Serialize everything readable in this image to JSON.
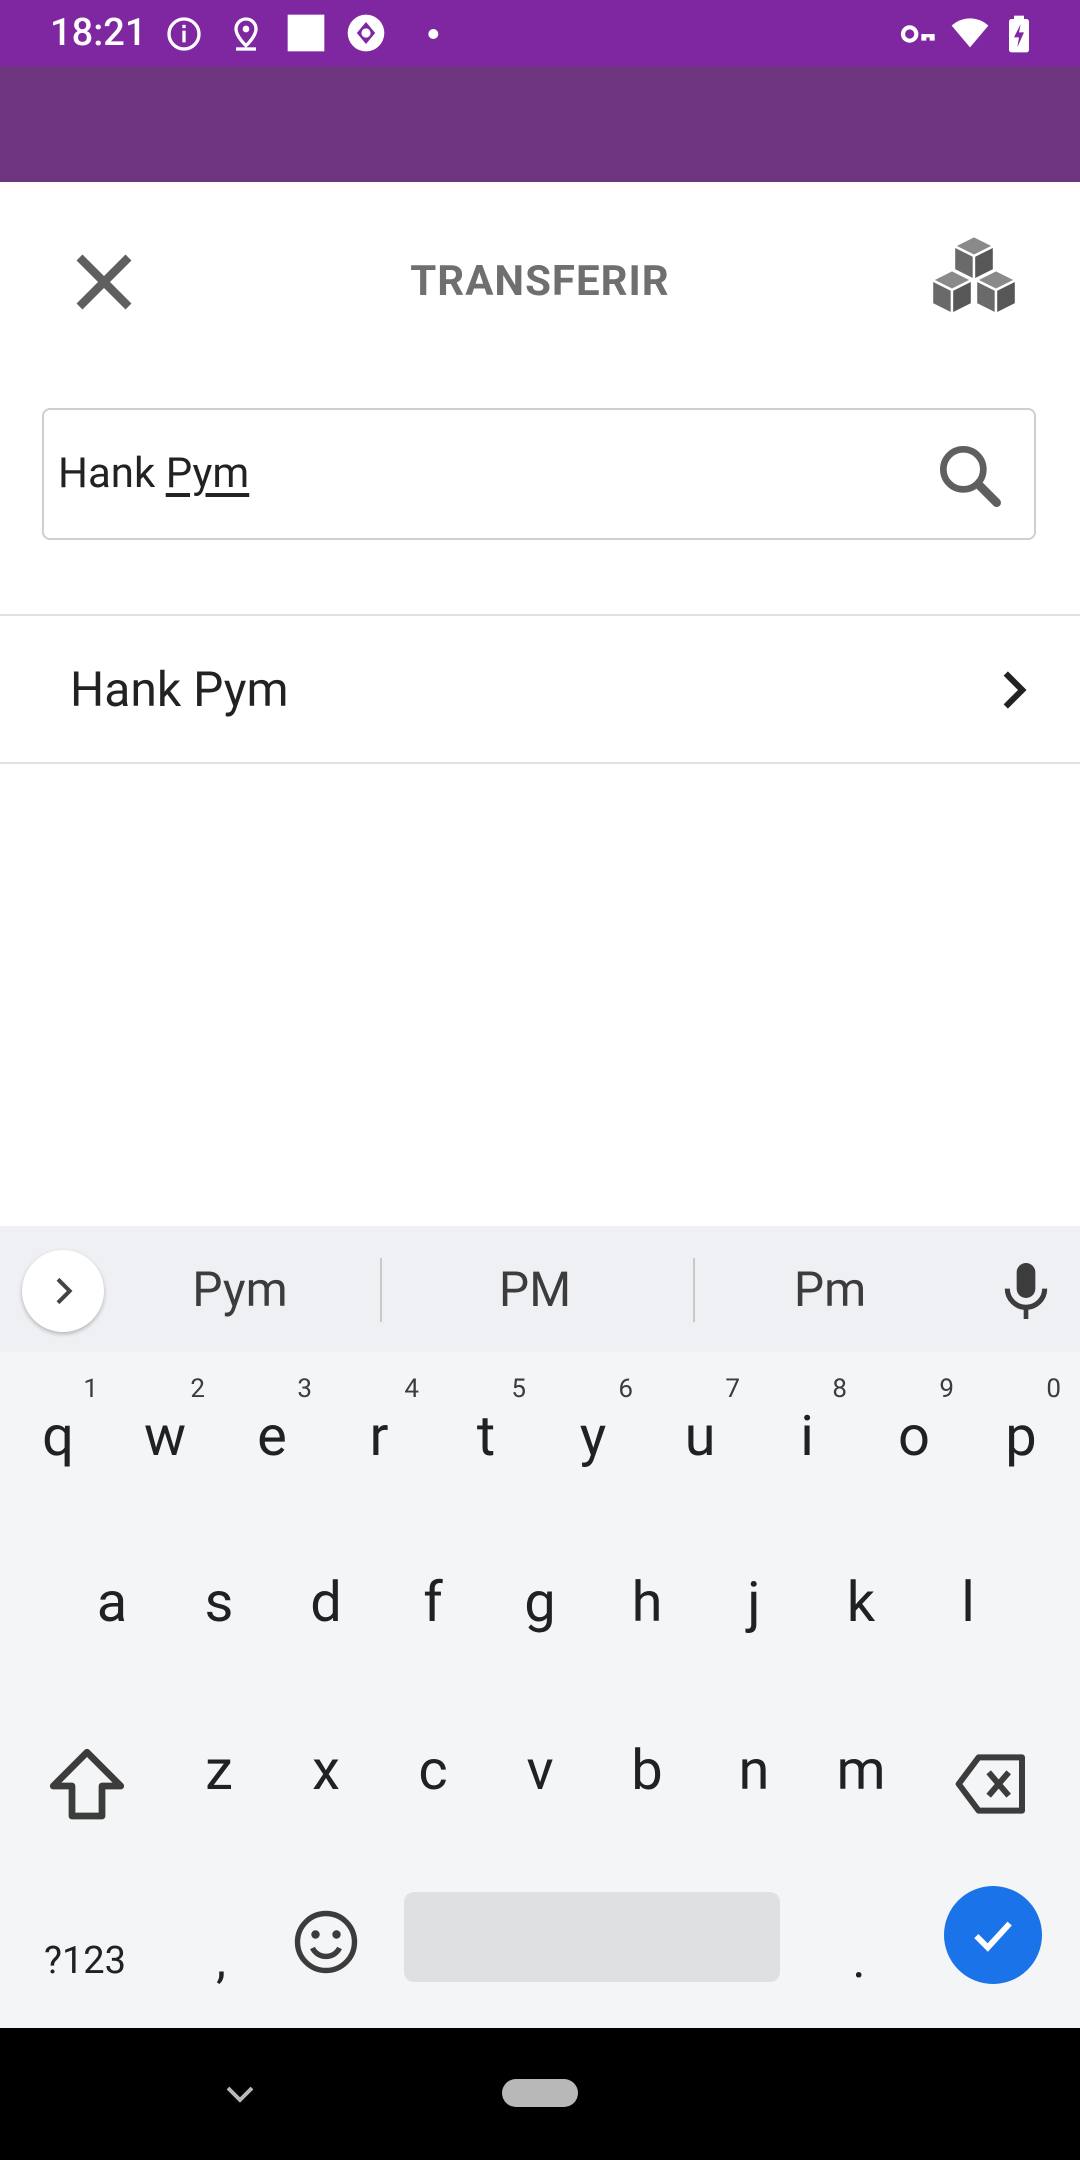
{
  "status_bar": {
    "time": "18:21",
    "bg_color": "#7f27a0",
    "icons": [
      "info-icon",
      "location-icon",
      "square-icon",
      "camera-app-icon",
      "dot-icon",
      "vpn-key-icon",
      "wifi-icon",
      "battery-charging-icon"
    ]
  },
  "header": {
    "title": "TRANSFERIR",
    "close_icon": "close-icon",
    "cubes_icon": "cubes-icon",
    "band_color": "#6c357d"
  },
  "search": {
    "value_prefix": "Hank ",
    "value_composing": "Pym",
    "icon": "search-icon"
  },
  "results": [
    {
      "label": "Hank Pym"
    }
  ],
  "keyboard": {
    "suggestions": [
      "Pym",
      "PM",
      "Pm"
    ],
    "row1": [
      {
        "key": "q",
        "hint": "1"
      },
      {
        "key": "w",
        "hint": "2"
      },
      {
        "key": "e",
        "hint": "3"
      },
      {
        "key": "r",
        "hint": "4"
      },
      {
        "key": "t",
        "hint": "5"
      },
      {
        "key": "y",
        "hint": "6"
      },
      {
        "key": "u",
        "hint": "7"
      },
      {
        "key": "i",
        "hint": "8"
      },
      {
        "key": "o",
        "hint": "9"
      },
      {
        "key": "p",
        "hint": "0"
      }
    ],
    "row2": [
      "a",
      "s",
      "d",
      "f",
      "g",
      "h",
      "j",
      "k",
      "l"
    ],
    "row3": [
      "z",
      "x",
      "c",
      "v",
      "b",
      "n",
      "m"
    ],
    "symbols_label": "?123",
    "comma": ",",
    "period": ".",
    "enter_color": "#1a73e8"
  }
}
